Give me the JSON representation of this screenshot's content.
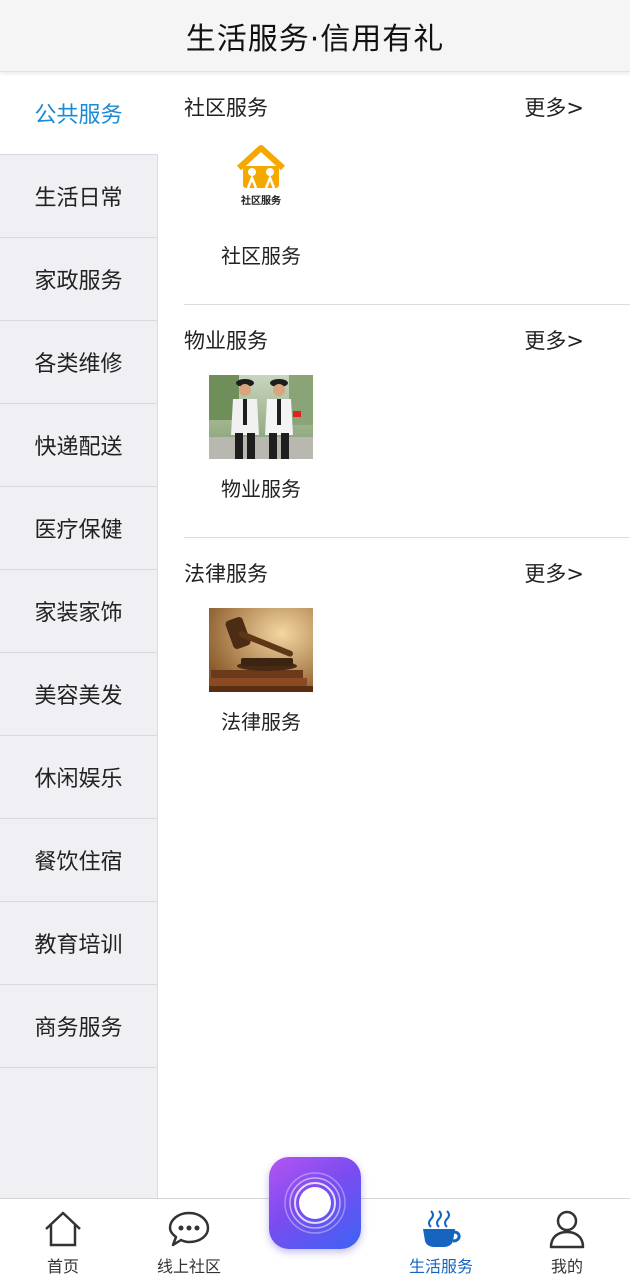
{
  "header": {
    "title": "生活服务·信用有礼"
  },
  "sidebar": {
    "items": [
      {
        "label": "公共服务",
        "active": true
      },
      {
        "label": "生活日常"
      },
      {
        "label": "家政服务"
      },
      {
        "label": "各类维修"
      },
      {
        "label": "快递配送"
      },
      {
        "label": "医疗保健"
      },
      {
        "label": "家装家饰"
      },
      {
        "label": "美容美发"
      },
      {
        "label": "休闲娱乐"
      },
      {
        "label": "餐饮住宿"
      },
      {
        "label": "教育培训"
      },
      {
        "label": "商务服务"
      }
    ]
  },
  "sections": [
    {
      "title": "社区服务",
      "more": "更多>",
      "tile": {
        "label": "社区服务",
        "logo_text": "社区服务",
        "icon": "community-service-logo"
      }
    },
    {
      "title": "物业服务",
      "more": "更多>",
      "tile": {
        "label": "物业服务",
        "icon": "security-guards-photo"
      }
    },
    {
      "title": "法律服务",
      "more": "更多>",
      "tile": {
        "label": "法律服务",
        "icon": "gavel-photo"
      }
    }
  ],
  "tabbar": {
    "items": [
      {
        "label": "首页",
        "icon": "home-icon"
      },
      {
        "label": "线上社区",
        "icon": "chat-bubble-icon"
      },
      {
        "label": "生活服务",
        "icon": "coffee-cup-icon",
        "active": true
      },
      {
        "label": "我的",
        "icon": "person-icon"
      }
    ],
    "center_button_icon": "ring-button-icon"
  },
  "colors": {
    "accent": "#1a8bd6",
    "tab_active": "#1565c0",
    "sidebar_bg": "#efeff4"
  }
}
